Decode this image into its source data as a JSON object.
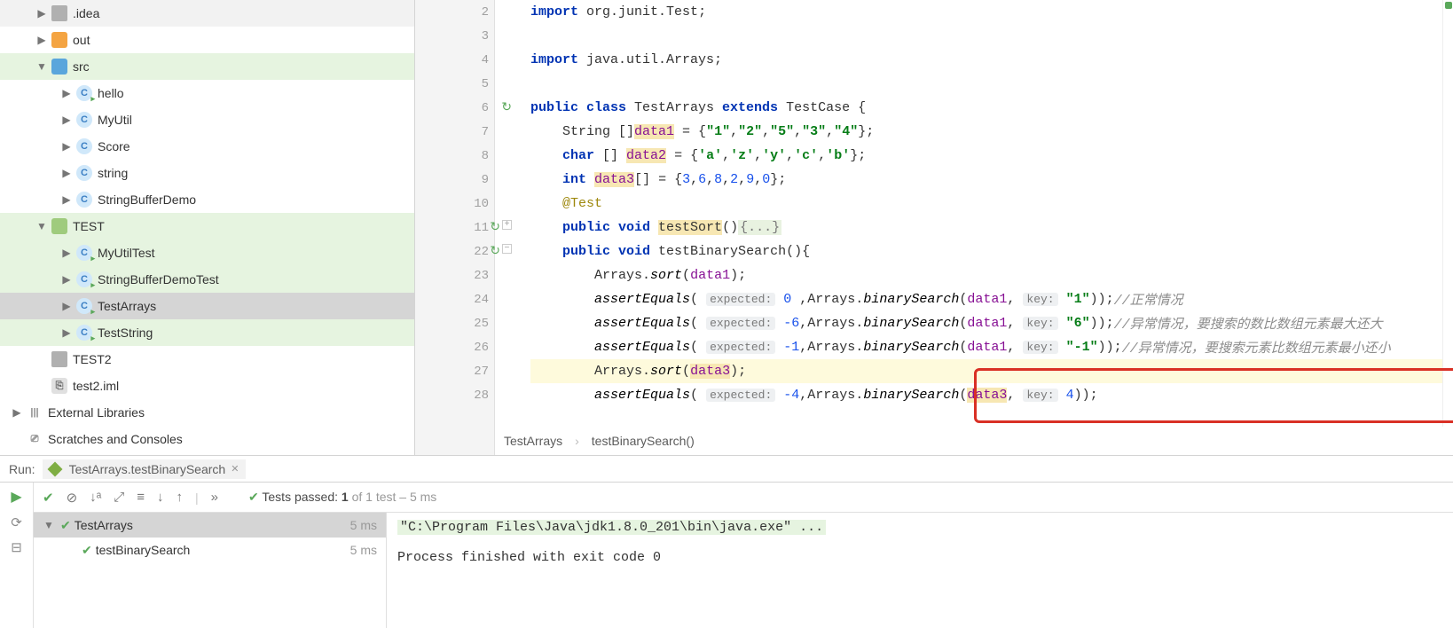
{
  "tree": [
    {
      "depth": 1,
      "arrow": "▶",
      "icon": "folder",
      "label": ".idea"
    },
    {
      "depth": 1,
      "arrow": "▶",
      "icon": "folder-o",
      "label": "out"
    },
    {
      "depth": 1,
      "arrow": "▼",
      "icon": "folder-b",
      "label": "src",
      "hl": true
    },
    {
      "depth": 2,
      "arrow": "▶",
      "icon": "class run",
      "label": "hello"
    },
    {
      "depth": 2,
      "arrow": "▶",
      "icon": "class",
      "label": "MyUtil"
    },
    {
      "depth": 2,
      "arrow": "▶",
      "icon": "class",
      "label": "Score"
    },
    {
      "depth": 2,
      "arrow": "▶",
      "icon": "class",
      "label": "string"
    },
    {
      "depth": 2,
      "arrow": "▶",
      "icon": "class",
      "label": "StringBufferDemo"
    },
    {
      "depth": 1,
      "arrow": "▼",
      "icon": "folder-g",
      "label": "TEST",
      "hl": true
    },
    {
      "depth": 2,
      "arrow": "▶",
      "icon": "class run",
      "label": "MyUtilTest",
      "hl": true
    },
    {
      "depth": 2,
      "arrow": "▶",
      "icon": "class run",
      "label": "StringBufferDemoTest",
      "hl": true
    },
    {
      "depth": 2,
      "arrow": "▶",
      "icon": "class run",
      "label": "TestArrays",
      "sel": true
    },
    {
      "depth": 2,
      "arrow": "▶",
      "icon": "class run",
      "label": "TestString",
      "hl": true
    },
    {
      "depth": 1,
      "arrow": " ",
      "icon": "folder",
      "label": "TEST2"
    },
    {
      "depth": 1,
      "arrow": " ",
      "icon": "iml",
      "label": "test2.iml"
    },
    {
      "depth": 0,
      "arrow": "▶",
      "icon": "lib",
      "label": "External Libraries"
    },
    {
      "depth": 0,
      "arrow": " ",
      "icon": "scratch",
      "label": "Scratches and Consoles"
    }
  ],
  "code_lines": [
    {
      "ln": 2
    },
    {
      "ln": 3
    },
    {
      "ln": 4
    },
    {
      "ln": 5
    },
    {
      "ln": 6,
      "run": true
    },
    {
      "ln": 7
    },
    {
      "ln": 8
    },
    {
      "ln": 9
    },
    {
      "ln": 10
    },
    {
      "ln": 11,
      "run": true,
      "fold": "+"
    },
    {
      "ln": 22,
      "run": true,
      "fold": "-"
    },
    {
      "ln": 23
    },
    {
      "ln": 24
    },
    {
      "ln": 25
    },
    {
      "ln": 26
    },
    {
      "ln": 27,
      "cur": true
    },
    {
      "ln": 28
    }
  ],
  "code": {
    "l2_import": "import",
    "l2_pkg": " org.junit.",
    "l2_test": "Test",
    "l2_end": ";",
    "l4_import": "import",
    "l4_rest": " java.util.Arrays;",
    "l6_pub": "public class ",
    "l6_name": "TestArrays",
    "l6_ext": " extends ",
    "l6_tc": "TestCase {",
    "l7": "    String []",
    "l7_f": "data1",
    "l7_eq": " = {",
    "l7_s1": "\"1\"",
    "l7_c": ",",
    "l7_s2": "\"2\"",
    "l7_s3": "\"5\"",
    "l7_s4": "\"3\"",
    "l7_s5": "\"4\"",
    "l7_end": "};",
    "l8": "    ",
    "l8_char": "char",
    "l8_arr": " [] ",
    "l8_f": "data2",
    "l8_eq": " = {",
    "l8_c1": "'a'",
    "l8_c": ",",
    "l8_c2": "'z'",
    "l8_c3": "'y'",
    "l8_c4": "'c'",
    "l8_c5": "'b'",
    "l8_end": "};",
    "l9": "    ",
    "l9_int": "int",
    "l9_sp": " ",
    "l9_f": "data3",
    "l9_arr": "[] = {",
    "l9_n1": "3",
    "l9_c": ",",
    "l9_n2": "6",
    "l9_n3": "8",
    "l9_n4": "2",
    "l9_n5": "9",
    "l9_n6": "0",
    "l9_end": "};",
    "l10": "    ",
    "l10_ann": "@Test",
    "l11": "    ",
    "l11_pv": "public void ",
    "l11_m": "testSort",
    "l11_p": "()",
    "l11_fold": "{...}",
    "l22": "    ",
    "l22_pv": "public void ",
    "l22_m": "testBinarySearch(){",
    "l23": "        Arrays.",
    "l23_m": "sort",
    "l23_p": "(",
    "l23_f": "data1",
    "l23_end": ");",
    "l24": "        ",
    "l24_m": "assertEquals",
    "l24_p": "( ",
    "l24_h1": "expected:",
    "l24_v": " 0 ",
    "l24_mid": ",Arrays.",
    "l24_bs": "binarySearch",
    "l24_p2": "(",
    "l24_f": "data1",
    "l24_c": ", ",
    "l24_h2": "key:",
    "l24_k": " \"1\"",
    "l24_end": "));",
    "l24_cmt": "//正常情况",
    "l25": "        ",
    "l25_m": "assertEquals",
    "l25_p": "( ",
    "l25_h1": "expected:",
    "l25_v": " -6",
    "l25_mid": ",Arrays.",
    "l25_bs": "binarySearch",
    "l25_p2": "(",
    "l25_f": "data1",
    "l25_c": ", ",
    "l25_h2": "key:",
    "l25_k": " \"6\"",
    "l25_end": "));",
    "l25_cmt": "//异常情况，要搜索的数比数组元素最大还大",
    "l26": "        ",
    "l26_m": "assertEquals",
    "l26_p": "( ",
    "l26_h1": "expected:",
    "l26_v": " -1",
    "l26_mid": ",Arrays.",
    "l26_bs": "binarySearch",
    "l26_p2": "(",
    "l26_f": "data1",
    "l26_c": ", ",
    "l26_h2": "key:",
    "l26_k": " \"-1\"",
    "l26_end": "));",
    "l26_cmt": "//异常情况，要搜索元素比数组元素最小还小",
    "l27": "        Arrays.",
    "l27_m": "sort",
    "l27_p": "(",
    "l27_f": "data3",
    "l27_end": ");",
    "l28": "        ",
    "l28_m": "assertEquals",
    "l28_p": "( ",
    "l28_h1": "expected:",
    "l28_v": " -4",
    "l28_mid": ",Arrays.",
    "l28_bs": "binarySearch",
    "l28_p2": "(",
    "l28_f": "data3",
    "l28_c": ", ",
    "l28_h2": "key:",
    "l28_k": " 4",
    "l28_end": "));"
  },
  "crumb1": "TestArrays",
  "crumb2": "testBinarySearch()",
  "run": {
    "label": "Run:",
    "tab": "TestArrays.testBinarySearch",
    "pass_pre": "Tests passed: ",
    "pass_n": "1",
    "pass_suf": " of 1 test – 5 ms",
    "tree": [
      {
        "name": "TestArrays",
        "dur": "5 ms",
        "depth": 0,
        "arrow": "▼",
        "sel": true
      },
      {
        "name": "testBinarySearch",
        "dur": "5 ms",
        "depth": 1,
        "arrow": " "
      }
    ],
    "cmd": "\"C:\\Program Files\\Java\\jdk1.8.0_201\\bin\\java.exe\" ...",
    "exit": "Process finished with exit code 0"
  }
}
